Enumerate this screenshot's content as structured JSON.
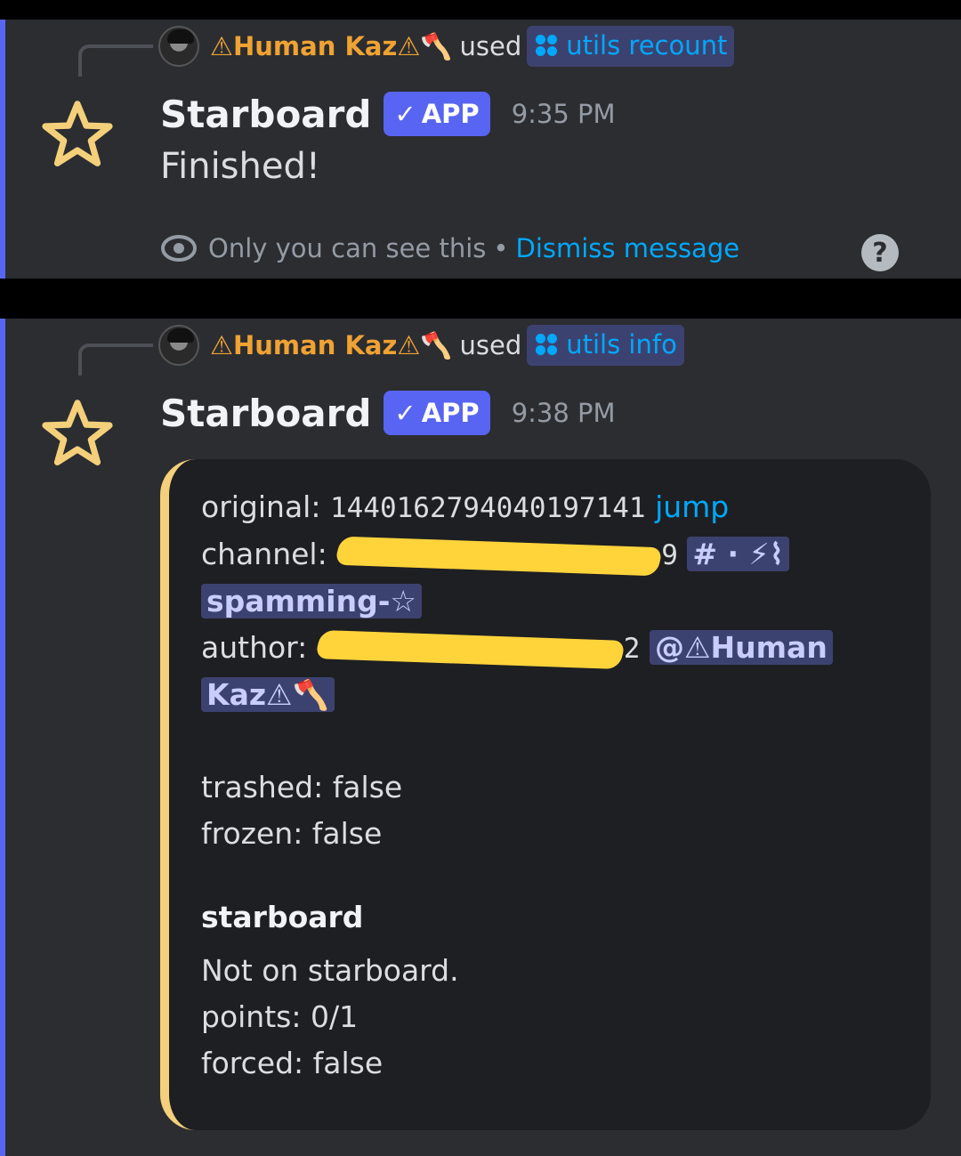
{
  "messages": [
    {
      "reply": {
        "user": "⚠Human Kaz⚠🪓",
        "verb": "used",
        "command": "utils recount"
      },
      "bot": {
        "name": "Starboard",
        "badge": "APP",
        "timestamp": "9:35 PM"
      },
      "text": "Finished!",
      "ephemeral": {
        "notice": "Only you can see this",
        "separator": "•",
        "dismiss": "Dismiss message",
        "help": "?"
      }
    },
    {
      "reply": {
        "user": "⚠Human Kaz⚠🪓",
        "verb": "used",
        "command": "utils info"
      },
      "bot": {
        "name": "Starboard",
        "badge": "APP",
        "timestamp": "9:38 PM"
      },
      "embed": {
        "original_label": "original:",
        "original_value": "1440162794040197141",
        "jump": "jump",
        "channel_label": "channel:",
        "channel_tail": "9",
        "channel_mention_1": "# · ⚡⌇",
        "channel_mention_2": "spamming-☆",
        "author_label": "author:",
        "author_tail": "2",
        "author_mention_1": "@⚠Human",
        "author_mention_2": "Kaz⚠🪓",
        "trashed": "trashed: false",
        "frozen": "frozen: false",
        "starboard_heading": "starboard",
        "starboard_status": "Not on starboard.",
        "points": "points: 0/1",
        "forced": "forced: false"
      },
      "accent_color": "#f5d07a"
    }
  ]
}
